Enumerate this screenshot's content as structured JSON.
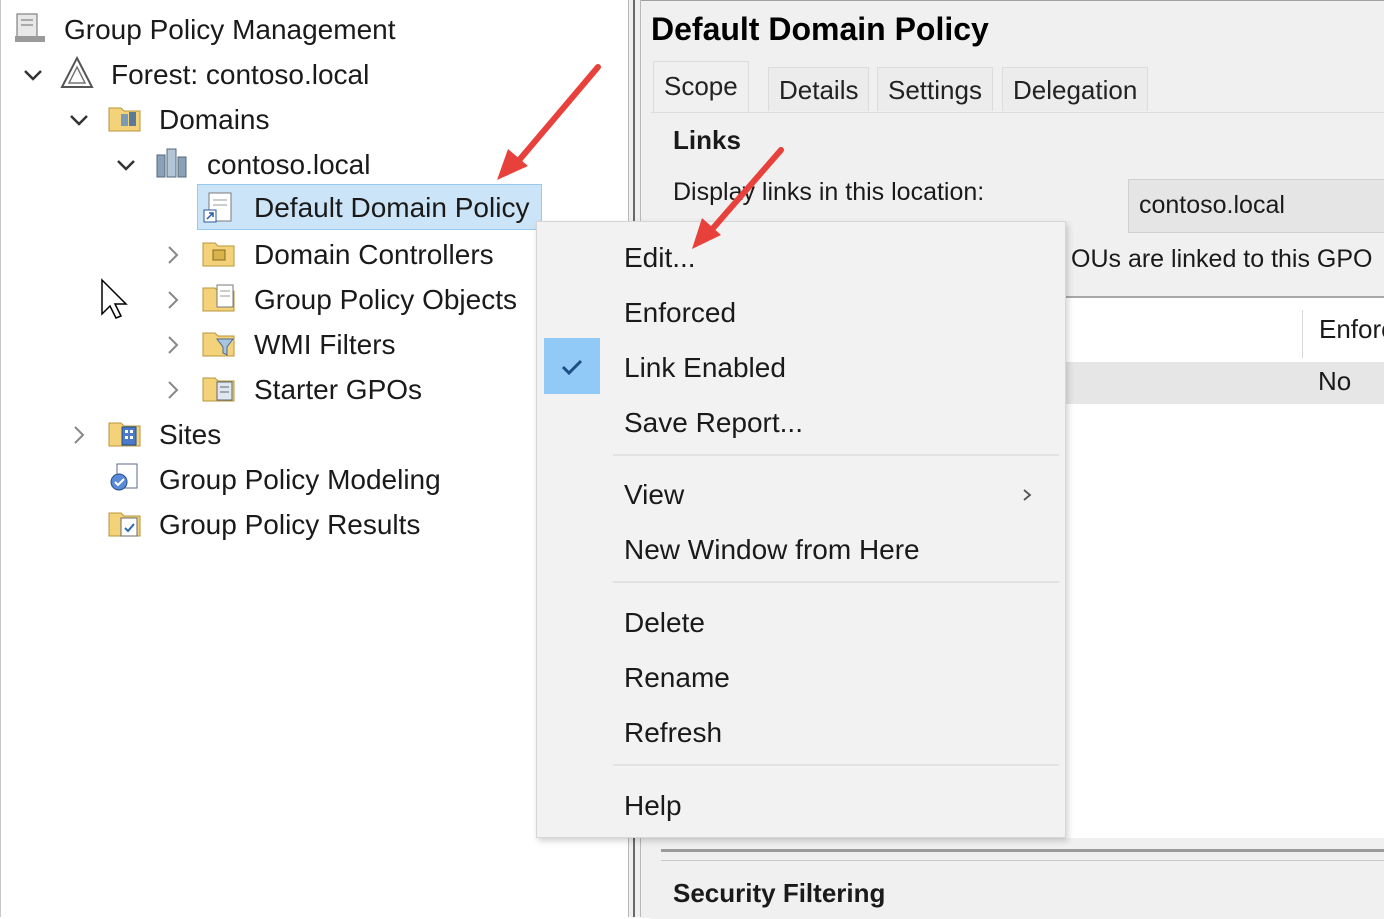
{
  "tree": {
    "root": "Group Policy Management",
    "forest": "Forest: contoso.local",
    "domains": "Domains",
    "domain": "contoso.local",
    "selected_gpo_link": "Default Domain Policy",
    "domain_controllers": "Domain Controllers",
    "group_policy_objects": "Group Policy Objects",
    "wmi_filters": "WMI Filters",
    "starter_gpos": "Starter GPOs",
    "sites": "Sites",
    "modeling": "Group Policy Modeling",
    "results": "Group Policy Results"
  },
  "details": {
    "title": "Default Domain Policy",
    "tabs": [
      "Scope",
      "Details",
      "Settings",
      "Delegation"
    ],
    "active_tab": "Scope",
    "links_heading": "Links",
    "display_links_label": "Display links in this location:",
    "location_value": "contoso.local",
    "ous_linked_text": "OUs are linked to this GPO",
    "enforced_column": "Enforced",
    "enforced_value": "No",
    "security_heading": "Security Filtering"
  },
  "context_menu": {
    "items": [
      {
        "label": "Edit...",
        "checked": false
      },
      {
        "label": "Enforced",
        "checked": false
      },
      {
        "label": "Link Enabled",
        "checked": true
      },
      {
        "label": "Save Report...",
        "checked": false
      },
      {
        "label": "View",
        "checked": false,
        "submenu": true
      },
      {
        "label": "New Window from Here",
        "checked": false
      },
      {
        "label": "Delete",
        "checked": false
      },
      {
        "label": "Rename",
        "checked": false
      },
      {
        "label": "Refresh",
        "checked": false
      },
      {
        "label": "Help",
        "checked": false
      }
    ]
  },
  "colors": {
    "selection": "#cce4f7",
    "menu_check": "#91c9f7",
    "arrow": "#e8413c"
  }
}
